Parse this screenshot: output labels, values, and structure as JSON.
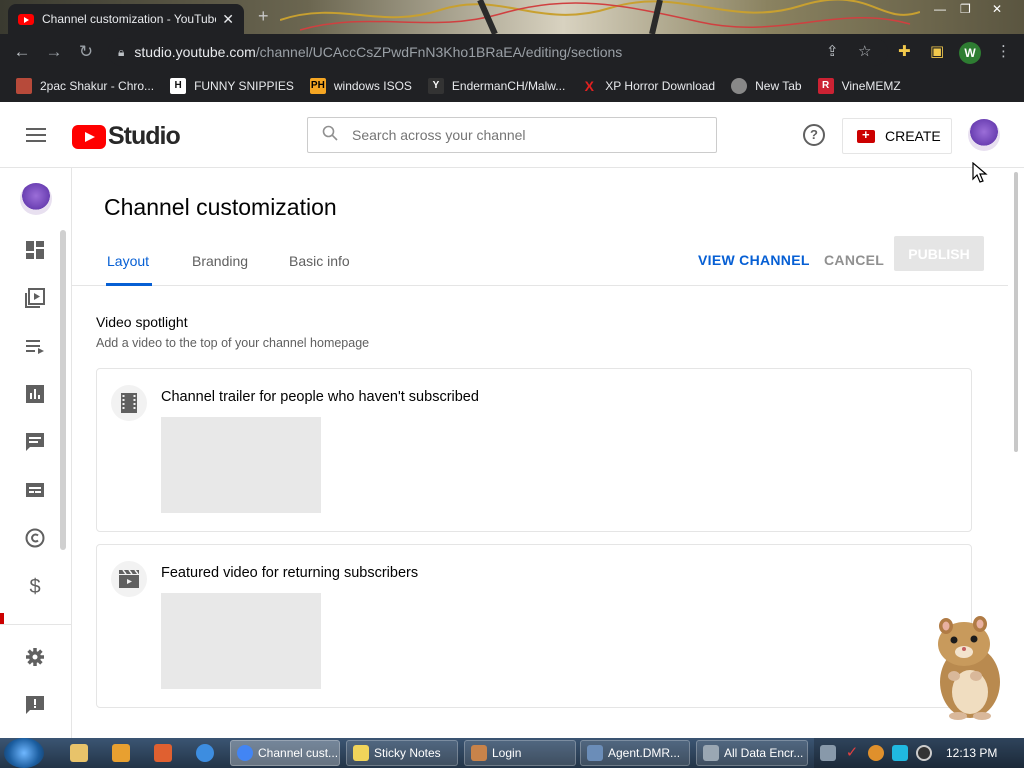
{
  "browser": {
    "tab_title": "Channel customization - YouTube Studio",
    "url_host": "studio.youtube.com",
    "url_path": "/channel/UCAccCsZPwdFnN3Kho1BRaEA/editing/sections",
    "profile_letter": "W",
    "bookmarks": [
      {
        "label": "2pac Shakur - Chro...",
        "icon": "2pac-favicon",
        "color": "#b74a3a"
      },
      {
        "label": "FUNNY SNIPPIES",
        "icon": "H-favicon",
        "color": "#111111"
      },
      {
        "label": "windows ISOS",
        "icon": "PH-favicon",
        "color": "#f5a623"
      },
      {
        "label": "EndermanCH/Malw...",
        "icon": "YP-favicon",
        "color": "#333333"
      },
      {
        "label": "XP Horror Download",
        "icon": "x-favicon",
        "color": "#cc0000"
      },
      {
        "label": "New Tab",
        "icon": "globe-favicon",
        "color": "#777777"
      },
      {
        "label": "VineMEMZ",
        "icon": "R-favicon",
        "color": "#cc2233"
      }
    ]
  },
  "studio": {
    "logo_text": "Studio",
    "search_placeholder": "Search across your channel",
    "create_label": "CREATE",
    "page_title": "Channel customization",
    "tabs": [
      {
        "label": "Layout",
        "active": true
      },
      {
        "label": "Branding",
        "active": false
      },
      {
        "label": "Basic info",
        "active": false
      }
    ],
    "view_channel": "VIEW CHANNEL",
    "cancel": "CANCEL",
    "publish": "PUBLISH",
    "section_title": "Video spotlight",
    "section_subtitle": "Add a video to the top of your channel homepage",
    "cards": [
      {
        "title": "Channel trailer for people who haven't subscribed",
        "icon": "film-icon"
      },
      {
        "title": "Featured video for returning subscribers",
        "icon": "clapper-icon"
      }
    ],
    "rail_icons": [
      "dashboard-icon",
      "content-icon",
      "playlists-icon",
      "analytics-icon",
      "comments-icon",
      "subtitles-icon",
      "copyright-icon",
      "earn-icon",
      "settings-icon",
      "feedback-icon"
    ]
  },
  "taskbar": {
    "tasks": [
      {
        "label": "Channel cust...",
        "color": "#4285f4"
      },
      {
        "label": "Sticky Notes",
        "color": "#f1d45a"
      },
      {
        "label": "Login",
        "color": "#c8834a"
      },
      {
        "label": "Agent.DMR...",
        "color": "#6b8db8"
      },
      {
        "label": "All Data Encr...",
        "color": "#9aa7b3"
      }
    ],
    "clock": "12:13 PM"
  }
}
